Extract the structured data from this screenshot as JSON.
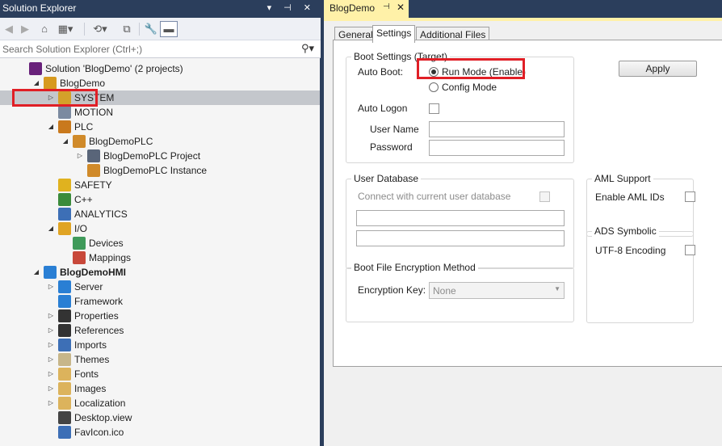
{
  "solution_explorer": {
    "title": "Solution Explorer",
    "title_controls": "▾ ⊣ ✕",
    "search": {
      "placeholder": "Search Solution Explorer (Ctrl+;)"
    },
    "tree": [
      {
        "label": "Solution 'BlogDemo' (2 projects)",
        "icon": "solution-icon",
        "color": "#68217a",
        "expander": ""
      },
      {
        "label": "BlogDemo",
        "icon": "twincat-project-icon",
        "color": "#d79a1f",
        "expander": "◢"
      },
      {
        "label": "SYSTEM",
        "icon": "system-icon",
        "color": "#d4a12a",
        "expander": "▷",
        "selected": true
      },
      {
        "label": "MOTION",
        "icon": "motion-icon",
        "color": "#7b8aa0",
        "expander": ""
      },
      {
        "label": "PLC",
        "icon": "plc-icon",
        "color": "#c9791d",
        "expander": "◢"
      },
      {
        "label": "BlogDemoPLC",
        "icon": "plc-project-icon",
        "color": "#d08a2a",
        "expander": "◢"
      },
      {
        "label": "BlogDemoPLC Project",
        "icon": "plc-program-icon",
        "color": "#596579",
        "expander": "▷"
      },
      {
        "label": "BlogDemoPLC Instance",
        "icon": "plc-instance-icon",
        "color": "#d08a2a",
        "expander": ""
      },
      {
        "label": "SAFETY",
        "icon": "safety-icon",
        "color": "#e0b21f",
        "expander": ""
      },
      {
        "label": "C++",
        "icon": "cpp-icon",
        "color": "#3b8b3b",
        "expander": ""
      },
      {
        "label": "ANALYTICS",
        "icon": "analytics-icon",
        "color": "#3d6fb6",
        "expander": ""
      },
      {
        "label": "I/O",
        "icon": "io-icon",
        "color": "#e0a424",
        "expander": "◢"
      },
      {
        "label": "Devices",
        "icon": "devices-icon",
        "color": "#3f9a5a",
        "expander": ""
      },
      {
        "label": "Mappings",
        "icon": "mappings-icon",
        "color": "#c8483a",
        "expander": ""
      },
      {
        "label": "BlogDemoHMI",
        "icon": "hmi-project-icon",
        "color": "#2a7fd4",
        "expander": "◢",
        "bold": true
      },
      {
        "label": "Server",
        "icon": "server-icon",
        "color": "#2a7fd4",
        "expander": "▷"
      },
      {
        "label": "Framework",
        "icon": "framework-icon",
        "color": "#2a7fd4",
        "expander": ""
      },
      {
        "label": "Properties",
        "icon": "wrench-icon",
        "color": "#333333",
        "expander": "▷"
      },
      {
        "label": "References",
        "icon": "references-icon",
        "color": "#333333",
        "expander": "▷"
      },
      {
        "label": "Imports",
        "icon": "imports-icon",
        "color": "#3d6fb6",
        "expander": "▷"
      },
      {
        "label": "Themes",
        "icon": "themes-icon",
        "color": "#c7b68a",
        "expander": "▷"
      },
      {
        "label": "Fonts",
        "icon": "folder-icon",
        "color": "#dcb35c",
        "expander": "▷"
      },
      {
        "label": "Images",
        "icon": "folder-icon",
        "color": "#dcb35c",
        "expander": "▷"
      },
      {
        "label": "Localization",
        "icon": "folder-icon",
        "color": "#dcb35c",
        "expander": "▷"
      },
      {
        "label": "Desktop.view",
        "icon": "view-icon",
        "color": "#444444",
        "expander": ""
      },
      {
        "label": "FavIcon.ico",
        "icon": "image-file-icon",
        "color": "#3d6fb6",
        "expander": ""
      }
    ]
  },
  "document": {
    "tab_title": "BlogDemo",
    "tab_pin": "⊣",
    "tab_close": "✕",
    "tabs": [
      "General",
      "Settings",
      "Additional Files"
    ],
    "active_tab": "Settings",
    "boot_settings": {
      "title": "Boot Settings (Target)",
      "auto_boot_label": "Auto Boot:",
      "run_mode_label": "Run Mode (Enable)",
      "config_mode_label": "Config Mode",
      "selected": "Run Mode (Enable)",
      "apply_label": "Apply",
      "auto_logon_label": "Auto Logon",
      "auto_logon_checked": false,
      "user_name_label": "User Name",
      "user_name_value": "",
      "password_label": "Password",
      "password_value": ""
    },
    "user_database": {
      "title": "User Database",
      "connect_label": "Connect with current user database",
      "connect_checked": false,
      "field1": "",
      "field2": ""
    },
    "aml_support": {
      "title": "AML Support",
      "enable_label": "Enable AML IDs",
      "checked": false
    },
    "ads_symbolic": {
      "title": "ADS Symbolic",
      "utf8_label": "UTF-8 Encoding",
      "checked": false
    },
    "encryption": {
      "title": "Boot File Encryption Method",
      "key_label": "Encryption Key:",
      "key_value": "None"
    }
  },
  "colors": {
    "highlight": "#e01f26",
    "chrome": "#2b3e5c",
    "active_tab": "#fff1a8"
  }
}
